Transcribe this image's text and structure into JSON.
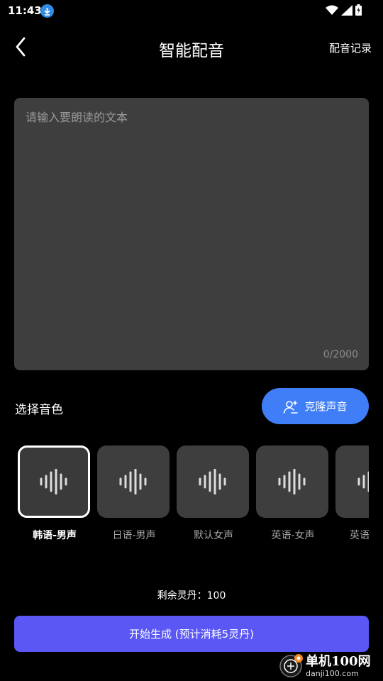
{
  "status_bar": {
    "time": "11:43"
  },
  "header": {
    "title": "智能配音",
    "record_label": "配音记录"
  },
  "editor": {
    "placeholder": "请输入要朗读的文本",
    "value": "",
    "char_count": "0/2000"
  },
  "voice_section": {
    "label": "选择音色",
    "clone_label": "克隆声音",
    "voices": [
      {
        "name": "韩语-男声",
        "selected": true
      },
      {
        "name": "日语-男声",
        "selected": false
      },
      {
        "name": "默认女声",
        "selected": false
      },
      {
        "name": "英语-女声",
        "selected": false
      },
      {
        "name": "英语",
        "selected": false
      }
    ]
  },
  "balance_text": "剩余灵丹：100",
  "generate_label": "开始生成 (预计消耗5灵丹)",
  "watermark": {
    "title": "单机100网",
    "url": "danji100.com"
  },
  "colors": {
    "accent_blue": "#3f7ef7",
    "primary_purple": "#5a57f5",
    "card_bg": "#3e3e3f"
  }
}
